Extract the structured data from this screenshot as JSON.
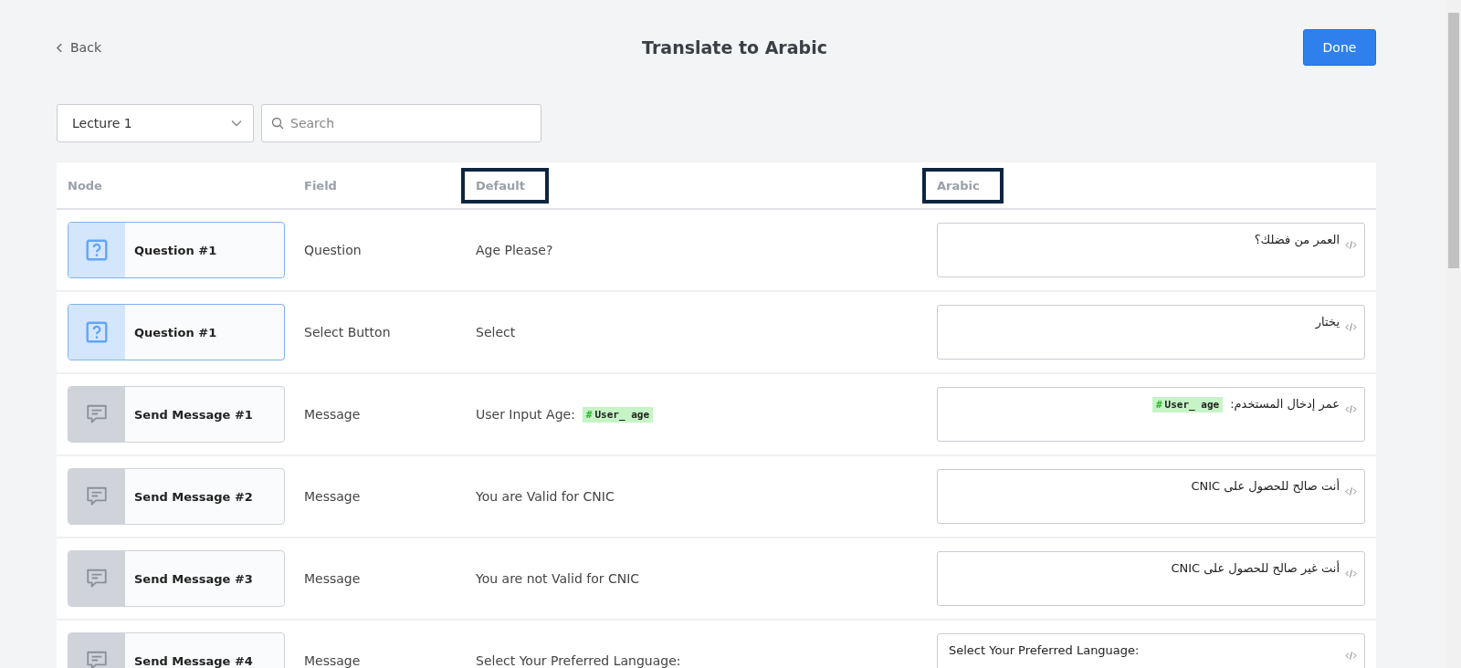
{
  "header": {
    "back": "Back",
    "title": "Translate to Arabic",
    "done": "Done"
  },
  "filters": {
    "lecture": "Lecture 1",
    "search_placeholder": "Search"
  },
  "table": {
    "columns": [
      {
        "label": "Node",
        "highlighted": false
      },
      {
        "label": "Field",
        "highlighted": false
      },
      {
        "label": "Default",
        "highlighted": true
      },
      {
        "label": "Arabic",
        "highlighted": true
      }
    ],
    "rows": [
      {
        "node": {
          "kind": "question",
          "label": "Question #1"
        },
        "field": "Question",
        "default": {
          "text": "Age Please?"
        },
        "arabic": {
          "text": "العمر من فضلك؟"
        }
      },
      {
        "node": {
          "kind": "question",
          "label": "Question #1"
        },
        "field": "Select Button",
        "default": {
          "text": "Select"
        },
        "arabic": {
          "text": "يختار"
        }
      },
      {
        "node": {
          "kind": "message",
          "label": "Send Message #1"
        },
        "field": "Message",
        "default": {
          "text": "User Input Age:",
          "hash": "#",
          "variable": "User_ age"
        },
        "arabic": {
          "text": "عمر إدخال المستخدم:",
          "hash": "#",
          "variable": "User_ age"
        }
      },
      {
        "node": {
          "kind": "message",
          "label": "Send Message #2"
        },
        "field": "Message",
        "default": {
          "text": "You are Valid for CNIC"
        },
        "arabic": {
          "text": "أنت صالح للحصول على CNIC"
        }
      },
      {
        "node": {
          "kind": "message",
          "label": "Send Message #3"
        },
        "field": "Message",
        "default": {
          "text": "You are not Valid for CNIC"
        },
        "arabic": {
          "text": "أنت غير صالح للحصول على CNIC"
        }
      },
      {
        "node": {
          "kind": "message",
          "label": "Send Message #4"
        },
        "field": "Message",
        "default": {
          "text": "Select Your Preferred Language:"
        },
        "arabic": {
          "text": "Select Your Preferred Language:"
        }
      }
    ]
  }
}
